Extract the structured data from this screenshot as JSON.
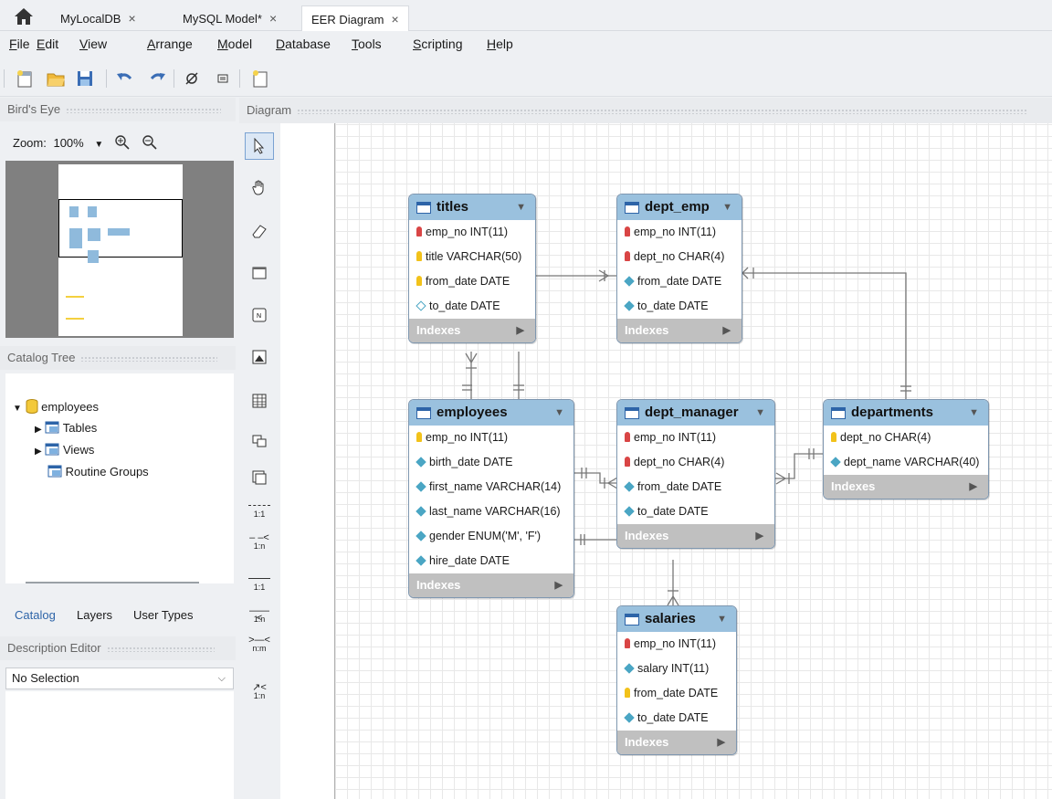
{
  "tabs": [
    {
      "label": "MyLocalDB",
      "close": "×"
    },
    {
      "label": "MySQL Model*",
      "close": "×"
    },
    {
      "label": "EER Diagram",
      "close": "×"
    }
  ],
  "menu": [
    {
      "label": "File",
      "u": "F",
      "rest": "ile"
    },
    {
      "label": "Edit",
      "u": "E",
      "rest": "dit"
    },
    {
      "label": "View",
      "u": "V",
      "rest": "iew"
    },
    {
      "label": "Arrange",
      "u": "A",
      "rest": "rrange"
    },
    {
      "label": "Model",
      "u": "M",
      "rest": "odel"
    },
    {
      "label": "Database",
      "u": "D",
      "rest": "atabase"
    },
    {
      "label": "Tools",
      "u": "T",
      "rest": "ools"
    },
    {
      "label": "Scripting",
      "u": "S",
      "rest": "cripting"
    },
    {
      "label": "Help",
      "u": "H",
      "rest": "elp"
    }
  ],
  "birds_eye": {
    "title": "Bird's Eye",
    "zoom_label": "Zoom:",
    "zoom_value": "100%"
  },
  "catalog": {
    "title": "Catalog Tree",
    "schema": "employees",
    "items": [
      "Tables",
      "Views",
      "Routine Groups"
    ]
  },
  "bottom_tabs": [
    "Catalog",
    "Layers",
    "User Types"
  ],
  "description": {
    "title": "Description Editor",
    "selection": "No Selection"
  },
  "diagram": {
    "title": "Diagram"
  },
  "palette_relations": [
    "1:1",
    "1:n",
    "1:1",
    "1:n",
    "n:m",
    "1:n"
  ],
  "entities": {
    "titles": {
      "name": "titles",
      "columns": [
        {
          "text": "emp_no INT(11)",
          "kind": "pk"
        },
        {
          "text": "title VARCHAR(50)",
          "kind": "pk"
        },
        {
          "text": "from_date DATE",
          "kind": "pk"
        },
        {
          "text": "to_date DATE",
          "kind": "col"
        }
      ]
    },
    "dept_emp": {
      "name": "dept_emp",
      "columns": [
        {
          "text": "emp_no INT(11)",
          "kind": "pkfk"
        },
        {
          "text": "dept_no CHAR(4)",
          "kind": "pkfk"
        },
        {
          "text": "from_date DATE",
          "kind": "col"
        },
        {
          "text": "to_date DATE",
          "kind": "col"
        }
      ]
    },
    "employees": {
      "name": "employees",
      "columns": [
        {
          "text": "emp_no INT(11)",
          "kind": "pk"
        },
        {
          "text": "birth_date DATE",
          "kind": "col"
        },
        {
          "text": "first_name VARCHAR(14)",
          "kind": "col"
        },
        {
          "text": "last_name VARCHAR(16)",
          "kind": "col"
        },
        {
          "text": "gender ENUM('M', 'F')",
          "kind": "col"
        },
        {
          "text": "hire_date DATE",
          "kind": "col"
        }
      ]
    },
    "dept_manager": {
      "name": "dept_manager",
      "columns": [
        {
          "text": "emp_no INT(11)",
          "kind": "pkfk"
        },
        {
          "text": "dept_no CHAR(4)",
          "kind": "pkfk"
        },
        {
          "text": "from_date DATE",
          "kind": "col"
        },
        {
          "text": "to_date DATE",
          "kind": "col"
        }
      ]
    },
    "departments": {
      "name": "departments",
      "columns": [
        {
          "text": "dept_no CHAR(4)",
          "kind": "pk"
        },
        {
          "text": "dept_name VARCHAR(40)",
          "kind": "col"
        }
      ]
    },
    "salaries": {
      "name": "salaries",
      "columns": [
        {
          "text": "emp_no INT(11)",
          "kind": "pkfk"
        },
        {
          "text": "salary INT(11)",
          "kind": "col"
        },
        {
          "text": "from_date DATE",
          "kind": "pk"
        },
        {
          "text": "to_date DATE",
          "kind": "col"
        }
      ]
    }
  },
  "indexes_label": "Indexes",
  "colors": {
    "header": "#9ac1de",
    "pk": "#f2c21a",
    "pkfk": "#d94545",
    "col": "#4ba6c4",
    "footer": "#c0c0c0"
  }
}
